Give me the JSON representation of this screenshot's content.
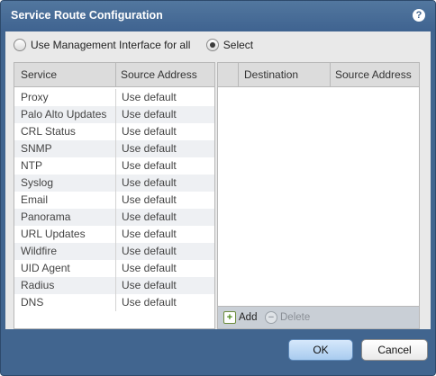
{
  "dialog": {
    "title": "Service Route Configuration",
    "help_glyph": "?"
  },
  "mode": {
    "option_all": "Use Management Interface for all",
    "option_select": "Select",
    "selected": "Select"
  },
  "services_table": {
    "headers": [
      "Service",
      "Source Address"
    ],
    "rows": [
      [
        "Proxy",
        "Use default"
      ],
      [
        "Palo Alto Updates",
        "Use default"
      ],
      [
        "CRL Status",
        "Use default"
      ],
      [
        "SNMP",
        "Use default"
      ],
      [
        "NTP",
        "Use default"
      ],
      [
        "Syslog",
        "Use default"
      ],
      [
        "Email",
        "Use default"
      ],
      [
        "Panorama",
        "Use default"
      ],
      [
        "URL Updates",
        "Use default"
      ],
      [
        "Wildfire",
        "Use default"
      ],
      [
        "UID Agent",
        "Use default"
      ],
      [
        "Radius",
        "Use default"
      ],
      [
        "DNS",
        "Use default"
      ]
    ]
  },
  "destination_table": {
    "headers": [
      "Destination",
      "Source Address"
    ],
    "add_label": "Add",
    "delete_label": "Delete"
  },
  "buttons": {
    "ok": "OK",
    "cancel": "Cancel"
  },
  "colors": {
    "frame": "#41658f",
    "content_bg": "#e9e9e9",
    "ok_button": "#a8cbef"
  }
}
